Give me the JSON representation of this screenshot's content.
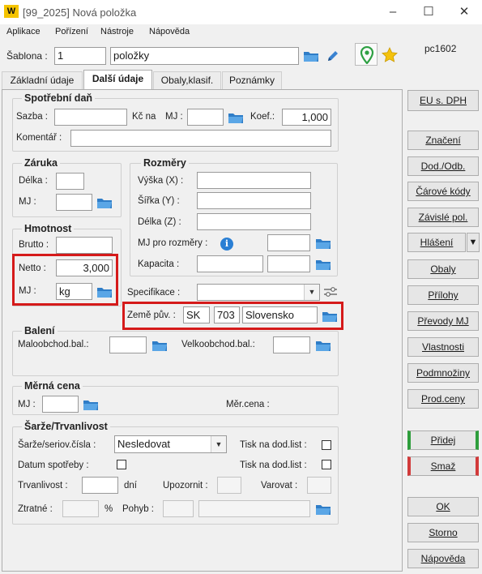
{
  "window": {
    "title": "[99_2025] Nová položka",
    "min": "–",
    "max": "☐",
    "close": "✕"
  },
  "menu": [
    "Aplikace",
    "Pořízení",
    "Nástroje",
    "Nápověda"
  ],
  "header": {
    "sablona_label": "Šablona :",
    "sablona_value": "1",
    "nazev_value": "položky",
    "pc_id": "pc1602"
  },
  "tabs": [
    "Základní údaje",
    "Další údaje",
    "Obaly,klasif.",
    "Poznámky"
  ],
  "spotrebni": {
    "title": "Spotřební daň",
    "sazba_label": "Sazba :",
    "kc_na_label": "Kč na",
    "mj_label": "MJ :",
    "koef_label": "Koef.:",
    "koef_value": "1,000",
    "komentar_label": "Komentář :"
  },
  "zaruka": {
    "title": "Záruka",
    "delka_label": "Délka :",
    "mj_label": "MJ :"
  },
  "rozmery": {
    "title": "Rozměry",
    "vyska_label": "Výška (X) :",
    "sirka_label": "Šířka (Y) :",
    "delka_label": "Délka (Z) :",
    "mj_rozmery_label": "MJ pro rozměry :",
    "kapacita_label": "Kapacita :"
  },
  "hmotnost": {
    "title": "Hmotnost",
    "brutto_label": "Brutto :",
    "netto_label": "Netto :",
    "netto_value": "3,000",
    "mj_label": "MJ :",
    "mj_value": "kg"
  },
  "specifikace_label": "Specifikace :",
  "zeme": {
    "label": "Země pův. :",
    "code": "SK",
    "num": "703",
    "name": "Slovensko"
  },
  "baleni": {
    "title": "Balení",
    "malo_label": "Maloobchod.bal.:",
    "velko_label": "Velkoobchod.bal.:"
  },
  "merna": {
    "title": "Měrná cena",
    "mj_label": "MJ :",
    "cena_label": "Měr.cena :"
  },
  "sarze": {
    "title": "Šarže/Trvanlivost",
    "sarze_label": "Šarže/seriov.čísla :",
    "sarze_value": "Nesledovat",
    "tisk1_label": "Tisk na dod.list :",
    "datum_label": "Datum spotřeby :",
    "tisk2_label": "Tisk na dod.list :",
    "trvan_label": "Trvanlivost :",
    "dni_label": "dní",
    "upoz_label": "Upozornit :",
    "varovat_label": "Varovat :",
    "ztratne_label": "Ztratné :",
    "pct_label": "%",
    "pohyb_label": "Pohyb :"
  },
  "buttons": {
    "eu": "EU s. DPH",
    "znaceni": "Značení",
    "dod": "Dod./Odb.",
    "carove": "Čárové kódy",
    "zavisle": "Závislé pol.",
    "hlaseni": "Hlášení",
    "obaly": "Obaly",
    "prilohy": "Přílohy",
    "prevody": "Převody MJ",
    "vlastnosti": "Vlastnosti",
    "podmnoziny": "Podmnožiny",
    "prodceny": "Prod.ceny",
    "pridej": "Přidej",
    "smaz": "Smaž",
    "ok": "OK",
    "storno": "Storno",
    "napoveda": "Nápověda"
  }
}
